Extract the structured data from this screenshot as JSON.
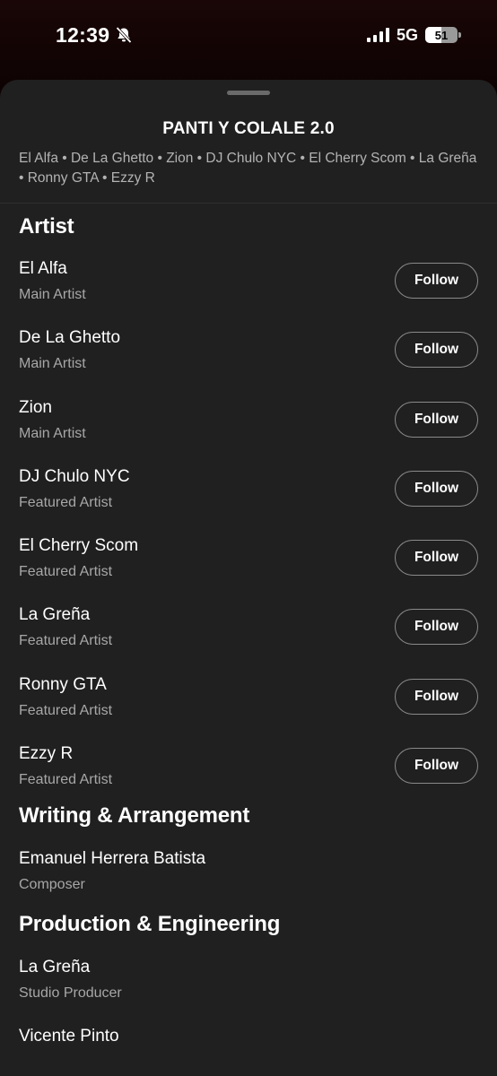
{
  "status_bar": {
    "time": "12:39",
    "network": "5G",
    "battery": "51",
    "icons": [
      "bell-slash-icon",
      "signal-icon",
      "battery-icon"
    ]
  },
  "song": {
    "title": "PANTI Y COLALE 2.0",
    "artists_line": "El Alfa • De La Ghetto • Zion • DJ Chulo NYC • El Cherry Scom • La Greña • Ronny GTA • Ezzy R"
  },
  "sections": {
    "artist": {
      "title": "Artist",
      "follow_label": "Follow",
      "items": [
        {
          "name": "El Alfa",
          "role": "Main Artist"
        },
        {
          "name": "De La Ghetto",
          "role": "Main Artist"
        },
        {
          "name": "Zion",
          "role": "Main Artist"
        },
        {
          "name": "DJ Chulo NYC",
          "role": "Featured Artist"
        },
        {
          "name": "El Cherry Scom",
          "role": "Featured Artist"
        },
        {
          "name": "La Greña",
          "role": "Featured Artist"
        },
        {
          "name": "Ronny GTA",
          "role": "Featured Artist"
        },
        {
          "name": "Ezzy R",
          "role": "Featured Artist"
        }
      ]
    },
    "writing": {
      "title": "Writing & Arrangement",
      "items": [
        {
          "name": "Emanuel Herrera Batista",
          "role": "Composer"
        }
      ]
    },
    "production": {
      "title": "Production & Engineering",
      "items": [
        {
          "name": "La Greña",
          "role": "Studio Producer"
        },
        {
          "name": "Vicente Pinto",
          "role": ""
        }
      ]
    }
  },
  "colors": {
    "sheet_background": "#202020",
    "secondary_text": "#a7a7a7",
    "button_border": "#8a8a8a"
  }
}
